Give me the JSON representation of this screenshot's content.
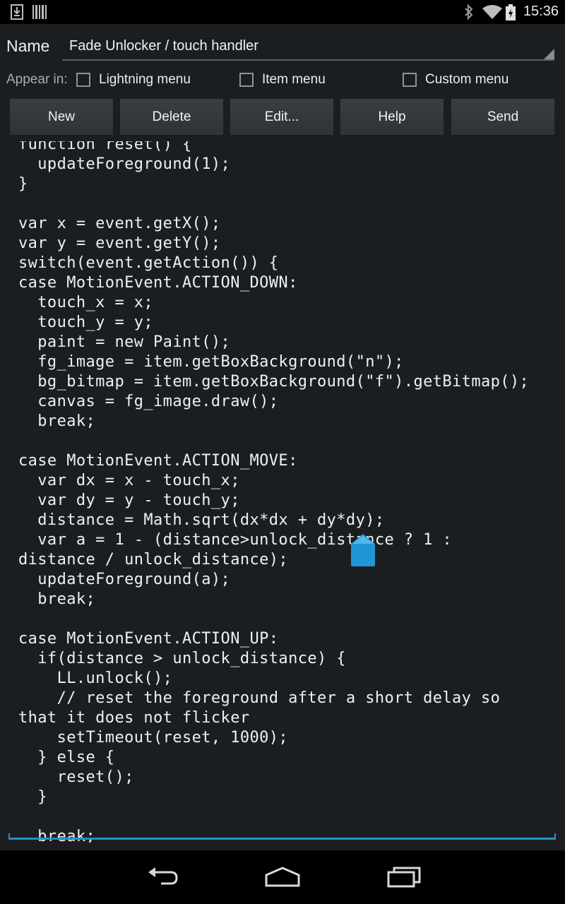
{
  "status_bar": {
    "time": "15:36",
    "icons": [
      "download-notification-icon",
      "barcode-notification-icon",
      "bluetooth-icon",
      "wifi-icon",
      "battery-charging-icon"
    ]
  },
  "name_field": {
    "label": "Name",
    "value": "Fade Unlocker / touch handler"
  },
  "appear_in": {
    "label": "Appear in:",
    "options": [
      {
        "label": "Lightning menu",
        "checked": false
      },
      {
        "label": "Item menu",
        "checked": false
      },
      {
        "label": "Custom menu",
        "checked": false
      }
    ]
  },
  "toolbar": {
    "buttons": [
      {
        "label": "New"
      },
      {
        "label": "Delete"
      },
      {
        "label": "Edit..."
      },
      {
        "label": "Help"
      },
      {
        "label": "Send"
      }
    ]
  },
  "code_editor": {
    "lines": [
      "function reset() {",
      "  updateForeground(1);",
      "}",
      "",
      "var x = event.getX();",
      "var y = event.getY();",
      "switch(event.getAction()) {",
      "case MotionEvent.ACTION_DOWN:",
      "  touch_x = x;",
      "  touch_y = y;",
      "  paint = new Paint();",
      "  fg_image = item.getBoxBackground(\"n\");",
      "  bg_bitmap = item.getBoxBackground(\"f\").getBitmap();",
      "  canvas = fg_image.draw();",
      "  break;",
      "",
      "case MotionEvent.ACTION_MOVE:",
      "  var dx = x - touch_x;",
      "  var dy = y - touch_y;",
      "  distance = Math.sqrt(dx*dx + dy*dy);",
      "  var a = 1 - (distance>unlock_distance ? 1 :",
      "distance / unlock_distance);",
      "  updateForeground(a);",
      "  break;",
      "",
      "case MotionEvent.ACTION_UP:",
      "  if(distance > unlock_distance) {",
      "    LL.unlock();",
      "    // reset the foreground after a short delay so",
      "that it does not flicker",
      "    setTimeout(reset, 1000);",
      "  } else {",
      "    reset();",
      "  }",
      "",
      "  break;"
    ]
  },
  "nav_bar": {
    "buttons": [
      "back-icon",
      "home-icon",
      "recent-apps-icon"
    ]
  },
  "colors": {
    "background": "#1b1e21",
    "accent": "#2a8fc2",
    "button": "#34383c"
  }
}
